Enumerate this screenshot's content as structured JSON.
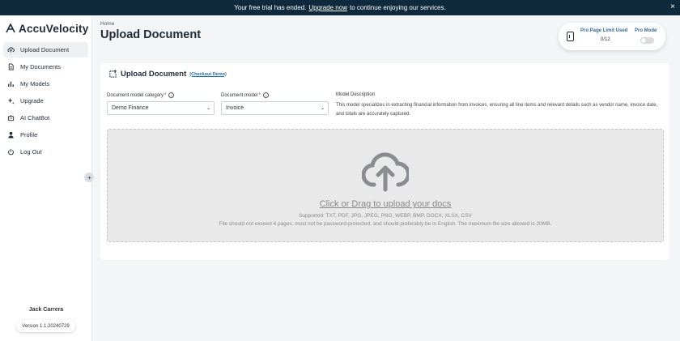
{
  "banner": {
    "text_before": "Your free trial has ended.",
    "link": "Upgrade now",
    "text_after": "to continue enjoying our services.",
    "close": "×"
  },
  "sidebar": {
    "logo_text": "AccuVelocity",
    "items": [
      {
        "label": "Upload Document",
        "icon": "cloud-upload-icon",
        "active": true
      },
      {
        "label": "My Documents",
        "icon": "document-icon"
      },
      {
        "label": "My Models",
        "icon": "bar-chart-icon"
      },
      {
        "label": "Upgrade",
        "icon": "sparkle-icon"
      },
      {
        "label": "AI ChatBot",
        "icon": "robot-icon"
      },
      {
        "label": "Profile",
        "icon": "user-icon"
      },
      {
        "label": "Log Out",
        "icon": "power-icon"
      }
    ],
    "user_name": "Jack Carrera",
    "version": "Version 1.1.20240729"
  },
  "header": {
    "breadcrumb": "Home",
    "title": "Upload Document"
  },
  "pro": {
    "limit_label": "Pro Page Limit Used",
    "limit_value": "0/12",
    "mode_label": "Pro Mode",
    "mode_on": false
  },
  "upload": {
    "title": "Upload Document",
    "demo_link": "(Checkout Demo)",
    "category_label": "Document model category",
    "category_value": "Demo Finance",
    "model_label": "Document model",
    "model_value": "Invoice",
    "description_label": "Model Description",
    "description_text": "This model specializes in extracting financial information from invoices, ensuring all line items and relevant details such as vendor name, invoice date, and totals are accurately captured.",
    "dropzone_main": "Click or Drag to upload your docs",
    "dropzone_supported": "Supported: TXT, PDF, JPG, JPEG, PNG, WEBP, BMP, DOCX, XLSX, CSV",
    "dropzone_note": "File should not exceed 4 pages, must not be password-protected, and should preferably be in English. The maximum file size allowed is 20MB."
  },
  "colors": {
    "banner_bg": "#0f2a3d",
    "accent_link": "#1e6bb8",
    "pro_label": "#2f6f9f"
  }
}
